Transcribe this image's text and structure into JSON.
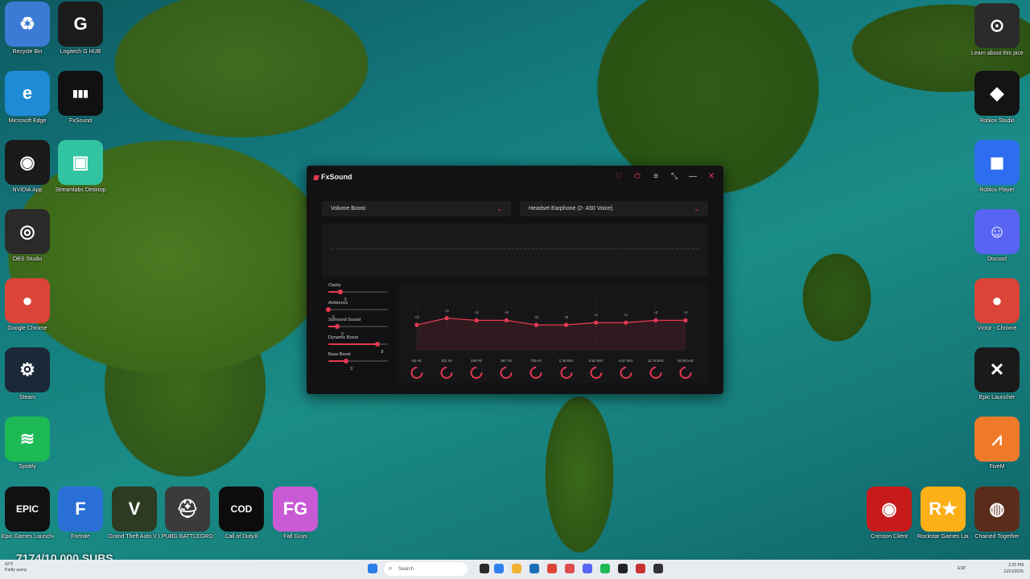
{
  "desktop": {
    "icons_left": [
      {
        "label": "Recycle Bin",
        "icon": "recycle-bin-icon",
        "color": "#3b7bd4",
        "glyph": "♻"
      },
      {
        "label": "Logitech G HUB",
        "icon": "logitech-g-hub-icon",
        "color": "#1b1b1b",
        "glyph": "G"
      },
      {
        "label": "Microsoft Edge",
        "icon": "edge-icon",
        "color": "#1f8bd6",
        "glyph": "e"
      },
      {
        "label": "FxSound",
        "icon": "fxsound-icon",
        "color": "#111111",
        "glyph": "▮▮▮"
      },
      {
        "label": "NVIDIA App",
        "icon": "nvidia-icon",
        "color": "#1a1a1a",
        "glyph": "◉"
      },
      {
        "label": "Streamlabs Desktop",
        "icon": "streamlabs-icon",
        "color": "#31c3a2",
        "glyph": "▣"
      },
      {
        "label": "OBS Studio",
        "icon": "obs-icon",
        "color": "#2a2a2a",
        "glyph": "◎"
      },
      {
        "label": "Google Chrome",
        "icon": "chrome-icon",
        "color": "#db4437",
        "glyph": "●"
      },
      {
        "label": "Steam",
        "icon": "steam-icon",
        "color": "#1b2838",
        "glyph": "⚙"
      },
      {
        "label": "Spotify",
        "icon": "spotify-icon",
        "color": "#1db954",
        "glyph": "≋"
      }
    ],
    "icons_bottom": [
      {
        "label": "Epic Games Launcher",
        "icon": "epic-games-icon",
        "color": "#111111",
        "glyph": "EPIC"
      },
      {
        "label": "Fortnite",
        "icon": "fortnite-icon",
        "color": "#2a6fd6",
        "glyph": "F"
      },
      {
        "label": "Grand Theft Auto V Legacy",
        "icon": "gta-v-icon",
        "color": "#2d3b22",
        "glyph": "V"
      },
      {
        "label": "PUBG BATTLEGROUNDS",
        "icon": "pubg-icon",
        "color": "#3b3b3b",
        "glyph": "⛑"
      },
      {
        "label": "Call of Duty®",
        "icon": "call-of-duty-icon",
        "color": "#0c0c0c",
        "glyph": "COD"
      },
      {
        "label": "Fall Guys",
        "icon": "fall-guys-icon",
        "color": "#c95ad6",
        "glyph": "FG"
      }
    ],
    "icons_right": [
      {
        "label": "Learn about this picture",
        "icon": "learn-picture-icon",
        "color": "#2b2b2b",
        "glyph": "⊙"
      },
      {
        "label": "Roblox Studio",
        "icon": "roblox-studio-icon",
        "color": "#141414",
        "glyph": "◆"
      },
      {
        "label": "Roblox Player",
        "icon": "roblox-player-icon",
        "color": "#2f6df0",
        "glyph": "◼"
      },
      {
        "label": "Discord",
        "icon": "discord-icon",
        "color": "#5865f2",
        "glyph": "☺"
      },
      {
        "label": "Victor - Chrome",
        "icon": "chrome-profile-icon",
        "color": "#db4437",
        "glyph": "●"
      },
      {
        "label": "Epic Launcher",
        "icon": "x-launcher-icon",
        "color": "#1a1a1a",
        "glyph": "✕"
      },
      {
        "label": "FiveM",
        "icon": "fivem-icon",
        "color": "#f07a2a",
        "glyph": "⩘"
      },
      {
        "label": "Crimson Client",
        "icon": "crimson-client-icon",
        "color": "#c71b1b",
        "glyph": "◉"
      },
      {
        "label": "Rockstar Games Launcher",
        "icon": "rockstar-icon",
        "color": "#fcaf17",
        "glyph": "R★"
      },
      {
        "label": "Chained Together",
        "icon": "chained-together-icon",
        "color": "#5a2d1a",
        "glyph": "◍"
      }
    ]
  },
  "fxsound": {
    "title": "FxSound",
    "preset": "Volume Boost",
    "output_device": "Headset Earphone (2- A50 Voice)",
    "effects": [
      {
        "name": "Clarity",
        "value": "3",
        "level": 0.2
      },
      {
        "name": "Ambience",
        "value": "0",
        "level": 0.0
      },
      {
        "name": "Surround Sound",
        "value": "2",
        "level": 0.15
      },
      {
        "name": "Dynamic Boost",
        "value": "8",
        "level": 0.82
      },
      {
        "name": "Bass Boost",
        "value": "3",
        "level": 0.3
      }
    ],
    "eq_bands": [
      {
        "freq": "62 Hz",
        "gain": "+0",
        "value": 0
      },
      {
        "freq": "101 Hz",
        "gain": "+3",
        "value": 3
      },
      {
        "freq": "240 Hz",
        "gain": "+2",
        "value": 2
      },
      {
        "freq": "397 Hz",
        "gain": "+2",
        "value": 2
      },
      {
        "freq": "735 Hz",
        "gain": "+0",
        "value": 0
      },
      {
        "freq": "1.36 kHz",
        "gain": "+0",
        "value": 0
      },
      {
        "freq": "2.52 kHz",
        "gain": "+1",
        "value": 1
      },
      {
        "freq": "4.67 kHz",
        "gain": "+1",
        "value": 1
      },
      {
        "freq": "11.76 kHz",
        "gain": "+2",
        "value": 2
      },
      {
        "freq": "16.00 kHz",
        "gain": "+2",
        "value": 2
      }
    ],
    "accent": "#e63950"
  },
  "overlay": {
    "subs_text": "7174/10,000 SUBS"
  },
  "taskbar": {
    "weather_temp": "62°F",
    "weather_desc": "Partly sunny",
    "search_placeholder": "Search",
    "language": "ESP",
    "time": "2:25 PM",
    "date": "11/21/2025"
  }
}
